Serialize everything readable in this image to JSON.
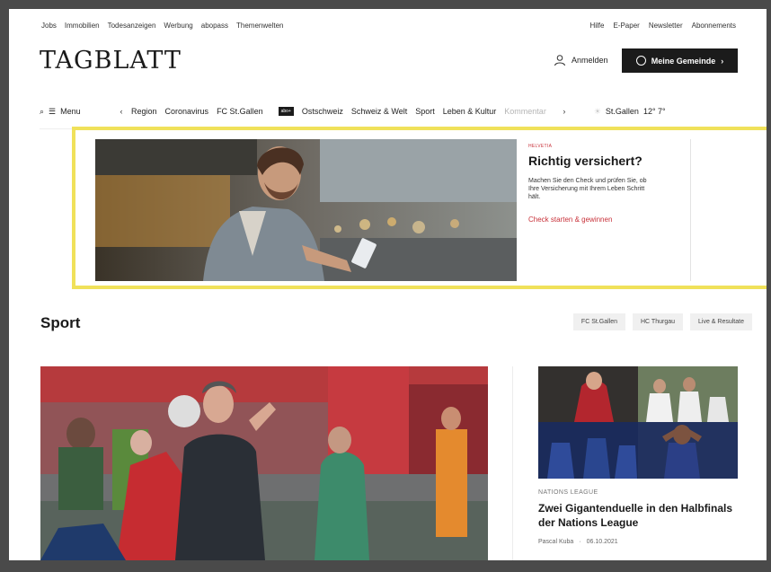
{
  "top_nav": {
    "items": [
      "Jobs",
      "Immobilien",
      "Todesanzeigen",
      "Werbung",
      "abopass",
      "Themenwelten"
    ]
  },
  "util_nav": {
    "items": [
      "Hilfe",
      "E-Paper",
      "Newsletter",
      "Abonnements"
    ]
  },
  "header": {
    "logo": "TAGBLATT",
    "login_label": "Anmelden",
    "gemeinde_label": "Meine Gemeinde"
  },
  "main_nav": {
    "menu_label": "Menu",
    "items_left": [
      {
        "label": "Region",
        "faded": false
      },
      {
        "label": "Coronavirus",
        "faded": false
      },
      {
        "label": "FC St.Gallen",
        "faded": false
      }
    ],
    "badge": "abo+",
    "items_right": [
      {
        "label": "Ostschweiz",
        "faded": false
      },
      {
        "label": "Schweiz & Welt",
        "faded": false
      },
      {
        "label": "Sport",
        "faded": false
      },
      {
        "label": "Leben & Kultur",
        "faded": false
      },
      {
        "label": "Kommentar",
        "faded": true
      }
    ],
    "weather_location": "St.Gallen",
    "weather_temp": "12° 7°"
  },
  "ad": {
    "brand": "HELVETIA",
    "title": "Richtig versichert?",
    "body": "Machen Sie den Check und prüfen Sie, ob Ihre Versicherung mit Ihrem Leben Schritt hält.",
    "cta": "Check starten & gewinnen",
    "frame_color": "#f0e15a",
    "accent_color": "#c8323a"
  },
  "section": {
    "title": "Sport",
    "tags": [
      "FC St.Gallen",
      "HC Thurgau",
      "Live & Resultate"
    ]
  },
  "side_article": {
    "label": "NATIONS LEAGUE",
    "title": "Zwei Gigantenduelle in den Halbfinals der Nations League",
    "author": "Pascal Kuba",
    "date": "06.10.2021"
  }
}
